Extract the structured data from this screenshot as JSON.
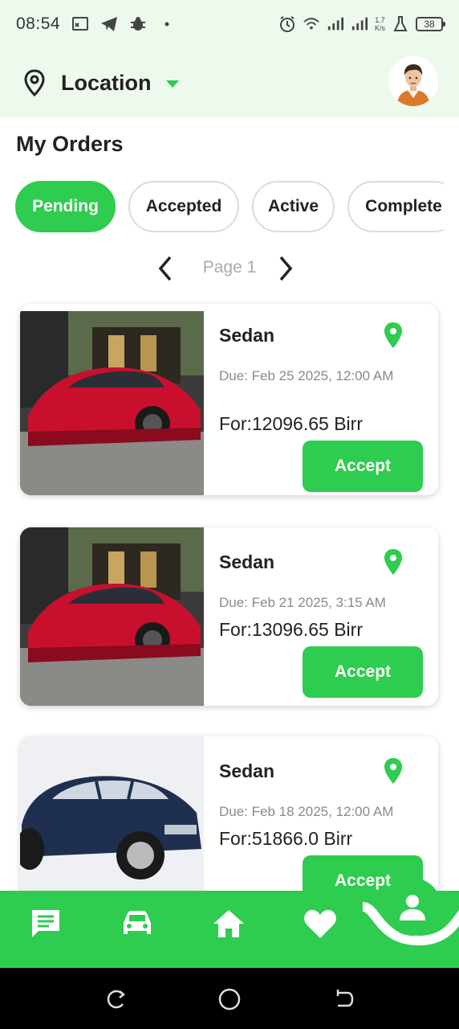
{
  "status_bar": {
    "time": "08:54",
    "dot": "•",
    "speed_value": "1.7",
    "speed_unit": "K/s",
    "battery": "38",
    "icons": [
      "screen-cast-icon",
      "telegram-icon",
      "bug-icon",
      "alarm-icon",
      "wifi-icon",
      "signal-icon",
      "signal-icon",
      "beaker-icon",
      "battery-icon"
    ]
  },
  "header": {
    "location_label": "Location",
    "icons": [
      "map-pin-icon",
      "caret-down-icon",
      "avatar"
    ]
  },
  "page": {
    "title": "My Orders"
  },
  "tabs": [
    {
      "label": "Pending",
      "active": true
    },
    {
      "label": "Accepted",
      "active": false
    },
    {
      "label": "Active",
      "active": false
    },
    {
      "label": "Complete",
      "active": false
    }
  ],
  "pager": {
    "label": "Page 1",
    "icons": [
      "chevron-left-icon",
      "chevron-right-icon"
    ]
  },
  "orders": [
    {
      "title": "Sedan",
      "due": "Due: Feb 25 2025, 12:00 AM",
      "price": "For:12096.65 Birr",
      "action": "Accept",
      "image": "red sports car"
    },
    {
      "title": "Sedan",
      "due": "Due: Feb 21 2025, 3:15 AM",
      "price": "For:13096.65 Birr",
      "action": "Accept",
      "image": "red sports car"
    },
    {
      "title": "Sedan",
      "due": "Due: Feb 18 2025, 12:00 AM",
      "price": "For:51866.0 Birr",
      "action": "Accept",
      "image": "dark blue sedan"
    }
  ],
  "bottom_nav": {
    "items": [
      "chat-icon",
      "car-icon",
      "home-icon",
      "heart-icon",
      "user-icon"
    ]
  },
  "system_nav": {
    "items": [
      "recent-apps-icon",
      "home-circle-icon",
      "back-icon"
    ]
  },
  "colors": {
    "accent": "#2ecc4f",
    "header_bg": "#eef9ee",
    "muted_text": "#8a8a8a"
  }
}
